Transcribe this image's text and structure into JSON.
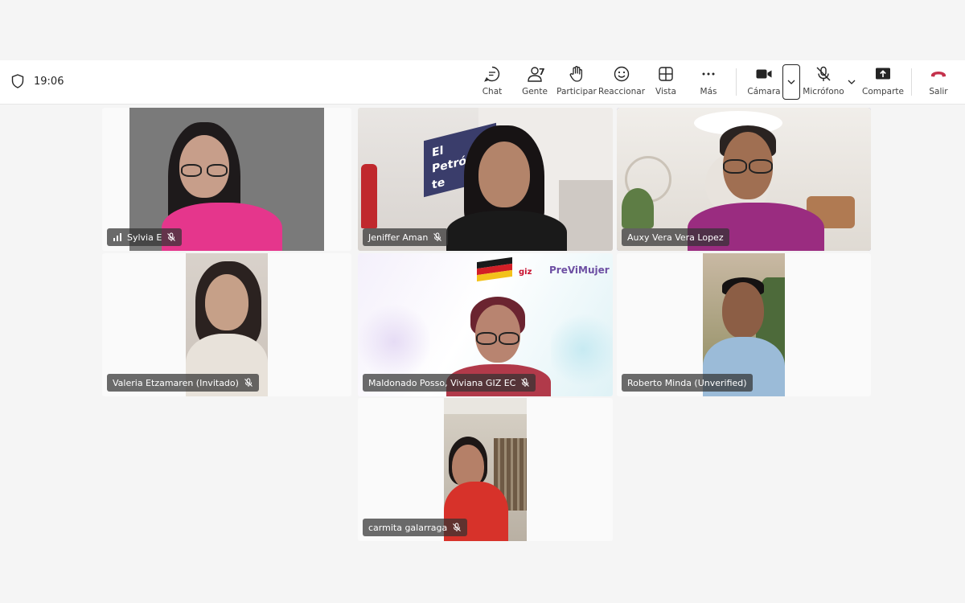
{
  "toolbar": {
    "timer": "19:06",
    "chat_label": "Chat",
    "people_label": "Gente",
    "people_count": "7",
    "raise_label": "Participar",
    "react_label": "Reaccionar",
    "view_label": "Vista",
    "more_label": "Más",
    "camera_label": "Cámara",
    "mic_label": "Micrófono",
    "share_label": "Comparte",
    "leave_label": "Salir",
    "leave_color": "#c4314b",
    "accent_color": "#6b6fd6"
  },
  "participants": [
    {
      "name": "Sylvia E",
      "muted": true,
      "signal": true
    },
    {
      "name": "Jeniffer Aman",
      "muted": true
    },
    {
      "name": "Auxy Vera Vera Lopez",
      "muted": false,
      "active": true
    },
    {
      "name": "Valeria Etzamaren (Invitado)",
      "muted": true
    },
    {
      "name": "Maldonado Posso, Viviana GIZ EC",
      "muted": true
    },
    {
      "name": "Roberto Minda (Unverified)",
      "muted": false
    },
    {
      "name": "carmita galarraga",
      "muted": true
    }
  ],
  "scene": {
    "banner_text": "El Petróleo te conecta",
    "logo_text": "PreViMujer",
    "logo_giz": "giz"
  }
}
